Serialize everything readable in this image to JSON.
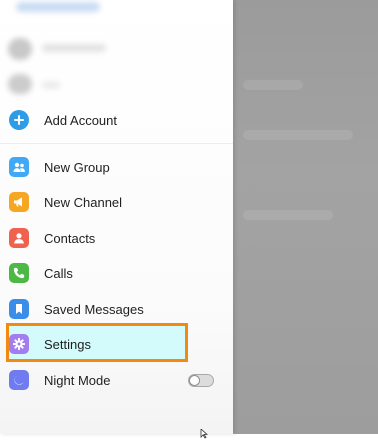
{
  "menu": {
    "add_account": "Add Account",
    "items": [
      {
        "label": "New Group",
        "icon": "people-icon",
        "color": "#3fa9f5"
      },
      {
        "label": "New Channel",
        "icon": "megaphone-icon",
        "color": "#f5a623"
      },
      {
        "label": "Contacts",
        "icon": "person-icon",
        "color": "#f0624d"
      },
      {
        "label": "Calls",
        "icon": "phone-icon",
        "color": "#4cb944"
      },
      {
        "label": "Saved Messages",
        "icon": "bookmark-icon",
        "color": "#3a8eea"
      },
      {
        "label": "Settings",
        "icon": "gear-icon",
        "color": "#a37cf0"
      },
      {
        "label": "Night Mode",
        "icon": "moon-icon",
        "color": "#6e7cf0"
      }
    ],
    "night_mode_enabled": false
  },
  "colors": {
    "highlight_border": "#f28a10",
    "highlight_fill": "#d3fbfb",
    "add_account_icon": "#2f9ce8"
  }
}
